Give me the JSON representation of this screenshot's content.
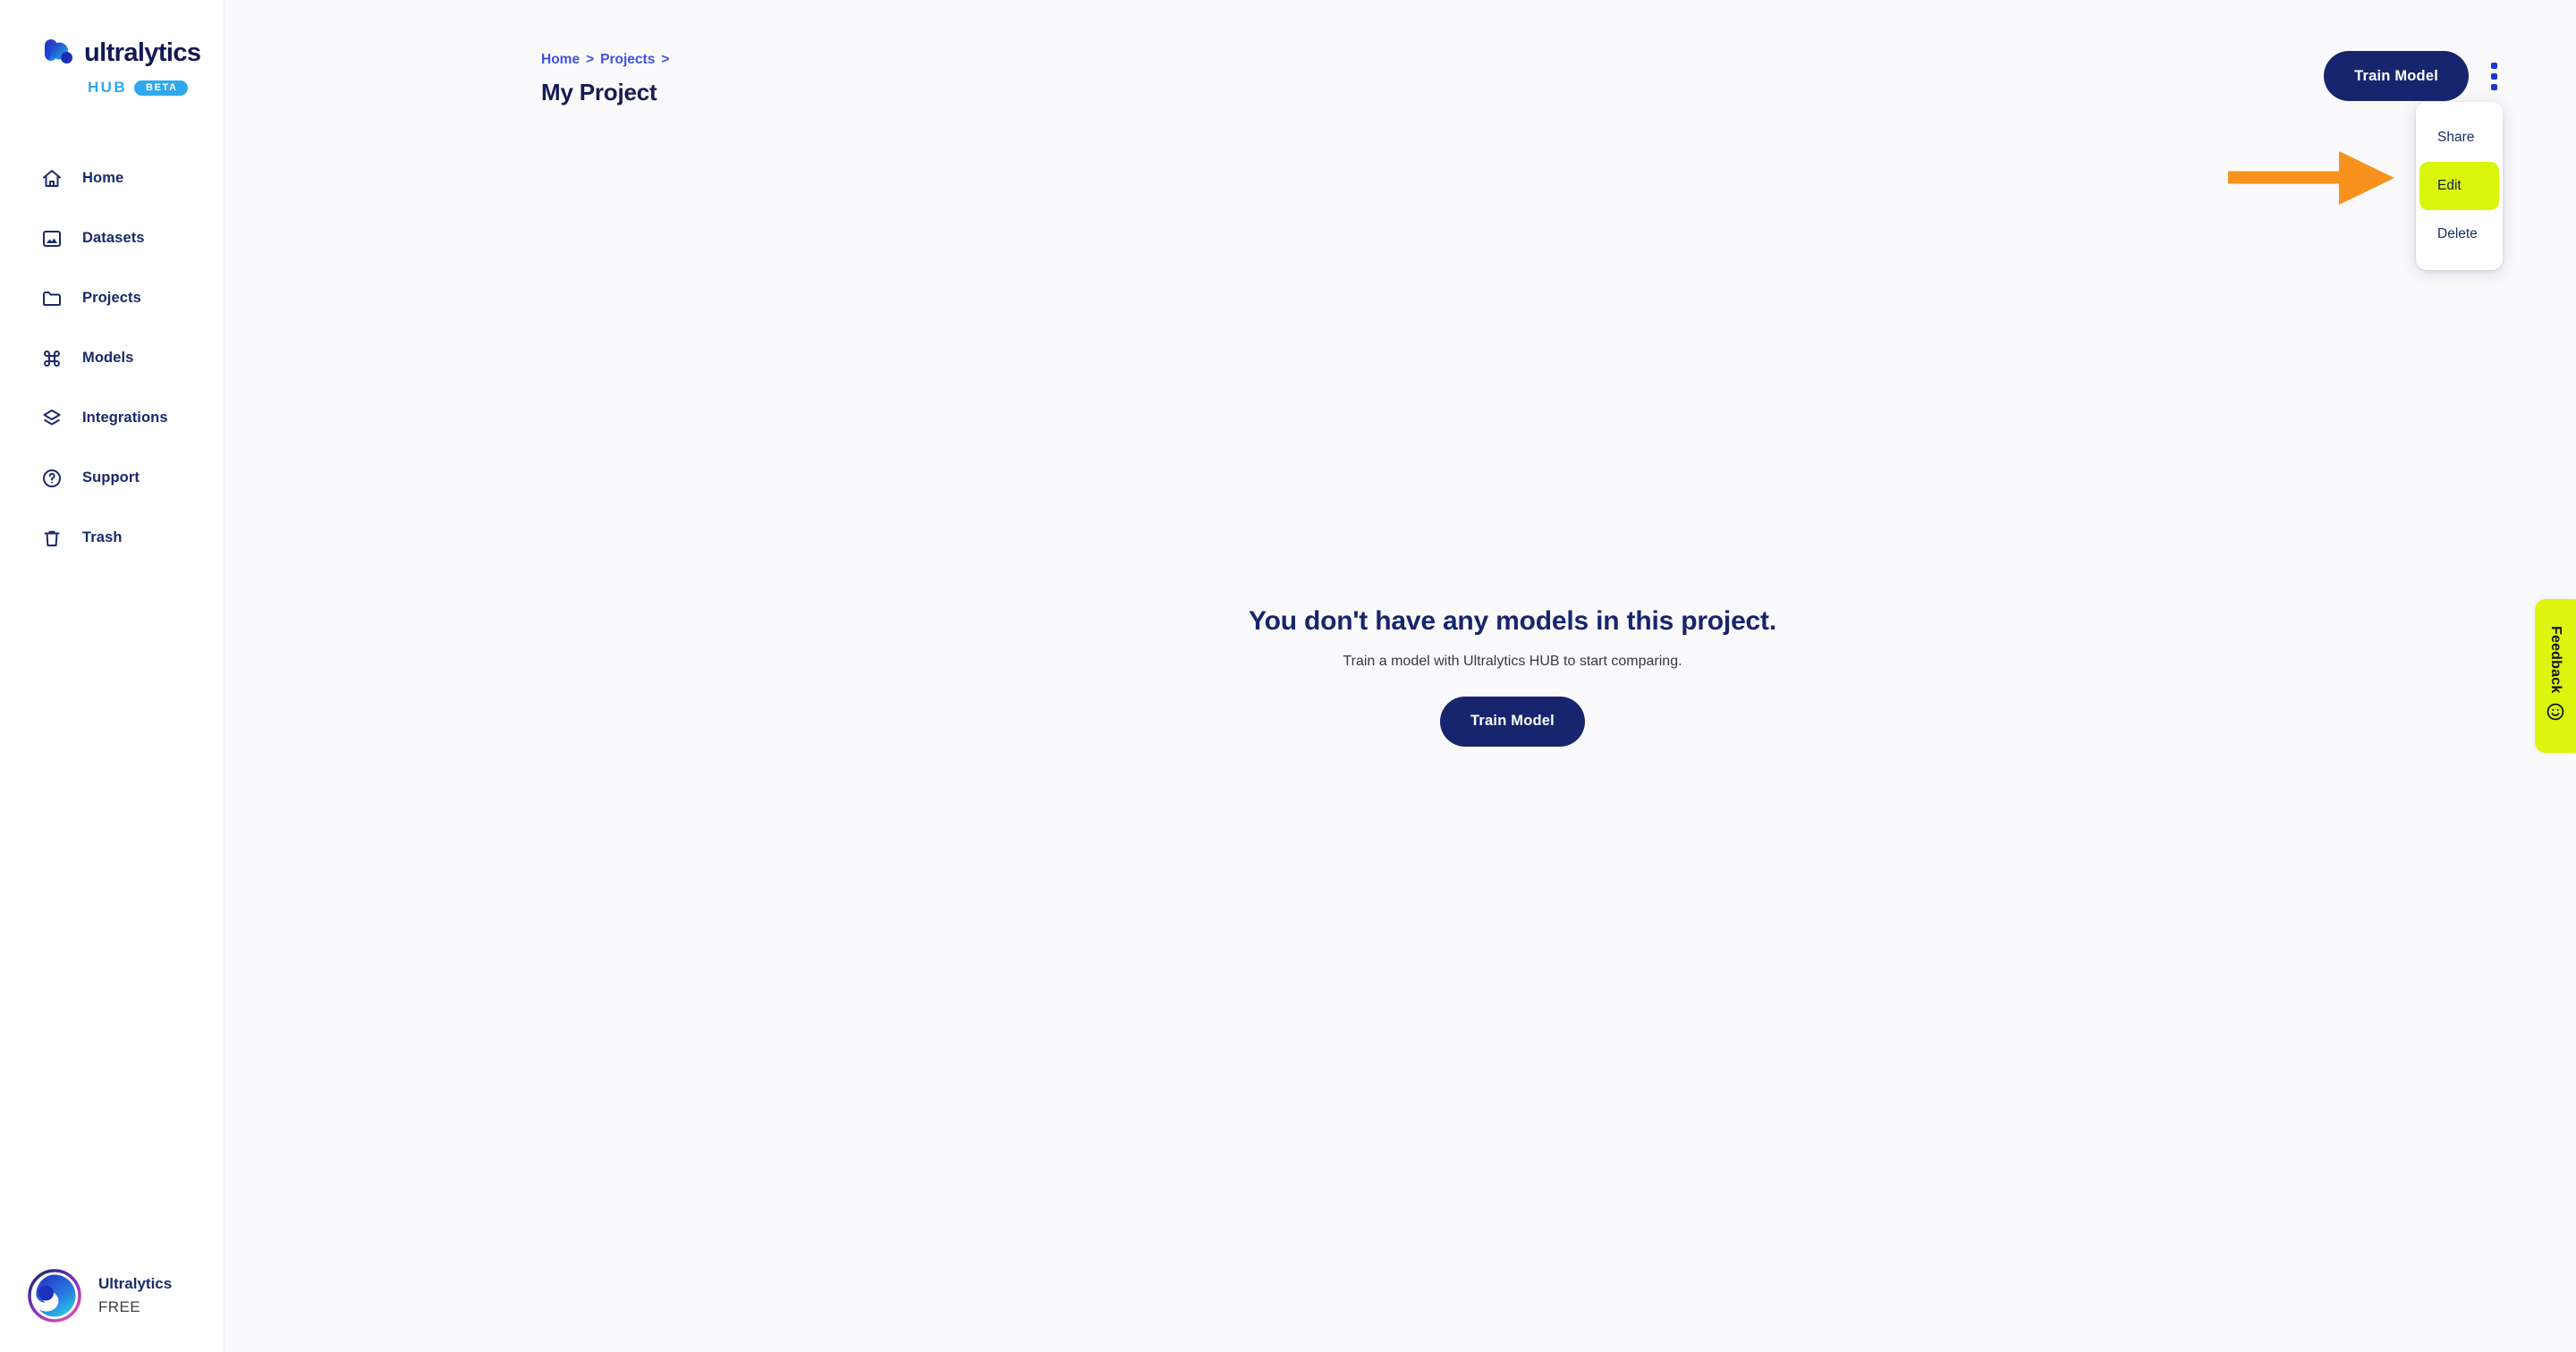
{
  "brand": {
    "name": "ultralytics",
    "product": "HUB",
    "badge": "BETA",
    "logo_icon": "ultralytics-logo-icon",
    "word_color": "#121a54",
    "hub_color": "#2fa8ee"
  },
  "sidebar": {
    "items": [
      {
        "label": "Home",
        "icon": "home-icon"
      },
      {
        "label": "Datasets",
        "icon": "image-icon"
      },
      {
        "label": "Projects",
        "icon": "folder-icon"
      },
      {
        "label": "Models",
        "icon": "command-icon"
      },
      {
        "label": "Integrations",
        "icon": "layers-icon"
      },
      {
        "label": "Support",
        "icon": "question-circle-icon"
      },
      {
        "label": "Trash",
        "icon": "trash-icon"
      }
    ],
    "profile": {
      "name": "Ultralytics",
      "plan": "FREE",
      "avatar_icon": "user-avatar-icon"
    }
  },
  "header": {
    "breadcrumb": [
      {
        "label": "Home",
        "sep": ">"
      },
      {
        "label": "Projects",
        "sep": ">"
      }
    ],
    "title": "My Project",
    "train_model_label": "Train Model",
    "kebab_icon": "more-vertical-icon"
  },
  "dropdown": {
    "items": [
      {
        "label": "Share",
        "highlighted": false
      },
      {
        "label": "Edit",
        "highlighted": true
      },
      {
        "label": "Delete",
        "highlighted": false
      }
    ],
    "highlight_color": "#d9f50c"
  },
  "annotation": {
    "arrow_icon": "right-arrow-annotation-icon",
    "arrow_color": "#f7921e",
    "points_at": "Edit"
  },
  "main": {
    "empty_title": "You don't have any models in this project.",
    "empty_subtitle": "Train a model with Ultralytics HUB to start comparing.",
    "empty_button_label": "Train Model"
  },
  "feedback": {
    "label": "Feedback",
    "icon": "smiley-face-icon",
    "background": "#dcf50f"
  },
  "colors": {
    "navy": "#17256e",
    "link_blue": "#3d52e0",
    "page_bg": "#fafafc",
    "sidebar_bg": "#ffffff"
  }
}
